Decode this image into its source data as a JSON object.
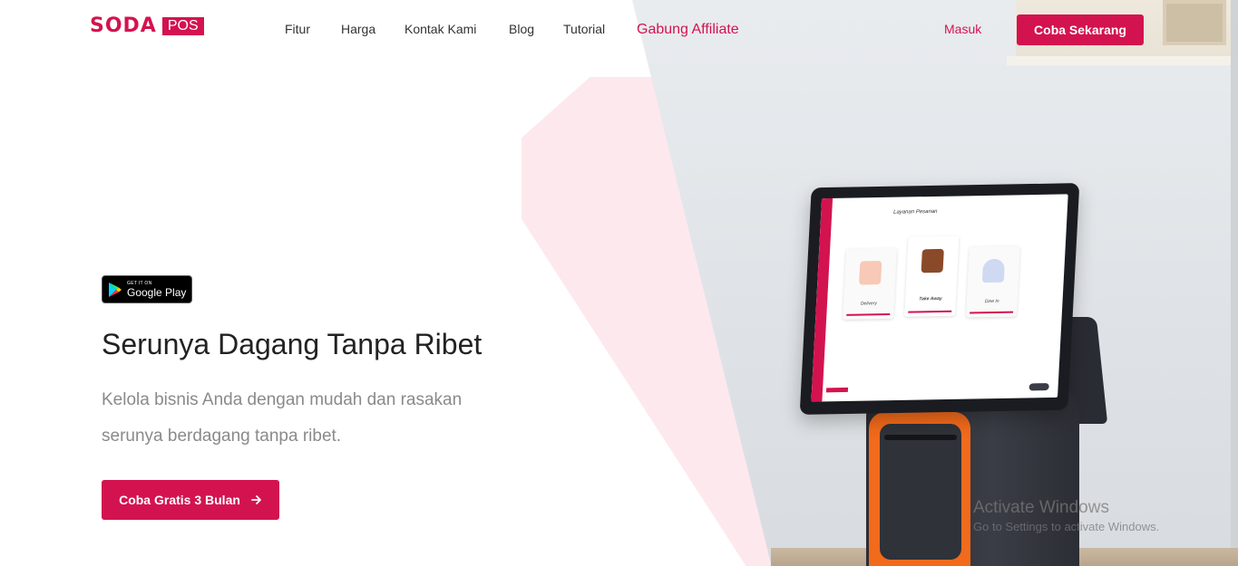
{
  "brand": {
    "name": "SODA",
    "suffix": "POS",
    "color": "#d3134f"
  },
  "nav": {
    "items": [
      {
        "label": "Fitur"
      },
      {
        "label": "Harga"
      },
      {
        "label": "Kontak Kami"
      },
      {
        "label": "Blog"
      },
      {
        "label": "Tutorial"
      }
    ],
    "affiliate": "Gabung Affiliate",
    "login": "Masuk",
    "cta": "Coba Sekarang"
  },
  "hero": {
    "badge": {
      "small": "GET IT ON",
      "big": "Google Play"
    },
    "title": "Serunya Dagang Tanpa Ribet",
    "description": "Kelola bisnis Anda dengan mudah dan rasakan serunya berdagang tanpa ribet.",
    "cta": "Coba Gratis 3 Bulan"
  },
  "device_screen": {
    "title": "Layanan Pesanan",
    "cards": [
      {
        "label": "Delivery"
      },
      {
        "label": "Take Away"
      },
      {
        "label": "Dine In"
      }
    ]
  },
  "watermark": {
    "title": "Activate Windows",
    "subtitle": "Go to Settings to activate Windows."
  }
}
